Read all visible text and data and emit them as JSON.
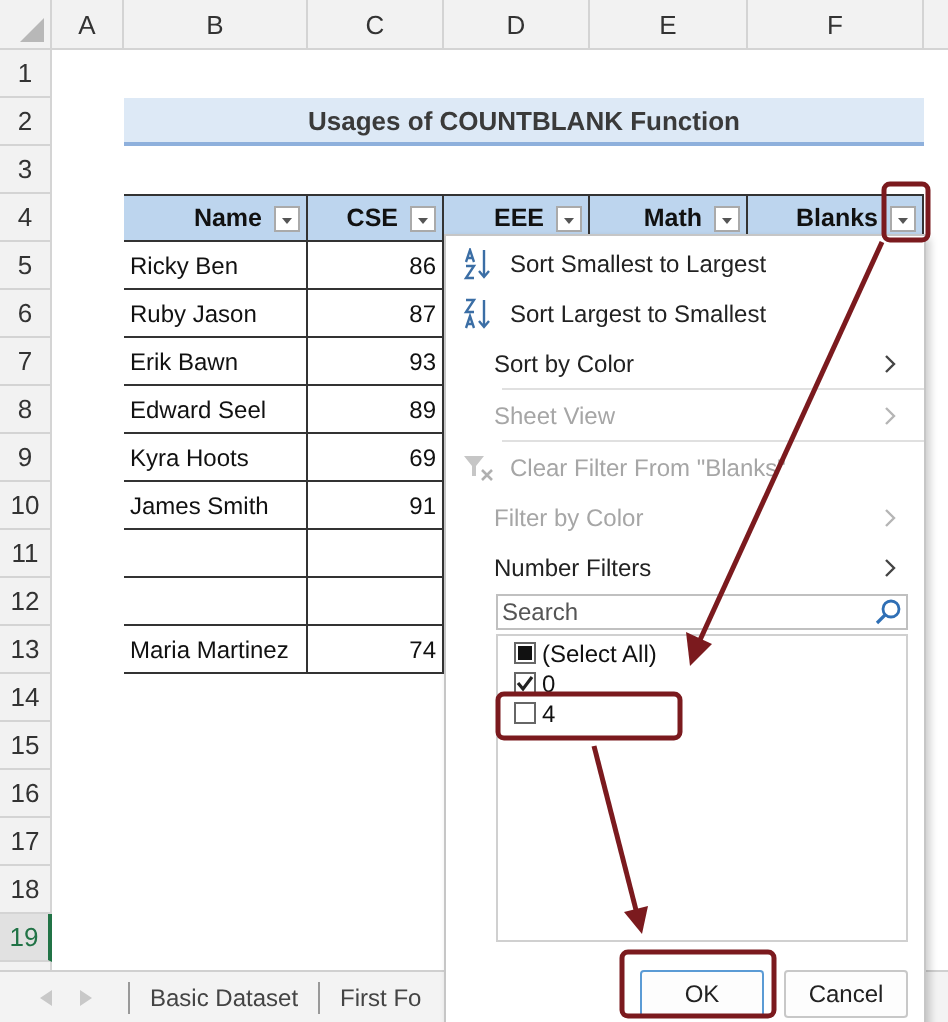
{
  "column_headers": [
    "A",
    "B",
    "C",
    "D",
    "E",
    "F"
  ],
  "row_headers": [
    {
      "label": "1",
      "selected": false
    },
    {
      "label": "2",
      "selected": false
    },
    {
      "label": "3",
      "selected": false
    },
    {
      "label": "4",
      "selected": false
    },
    {
      "label": "5",
      "selected": false
    },
    {
      "label": "6",
      "selected": false
    },
    {
      "label": "7",
      "selected": false
    },
    {
      "label": "8",
      "selected": false
    },
    {
      "label": "9",
      "selected": false
    },
    {
      "label": "10",
      "selected": false
    },
    {
      "label": "11",
      "selected": false
    },
    {
      "label": "12",
      "selected": false
    },
    {
      "label": "13",
      "selected": false
    },
    {
      "label": "14",
      "selected": false
    },
    {
      "label": "15",
      "selected": false
    },
    {
      "label": "16",
      "selected": false
    },
    {
      "label": "17",
      "selected": false
    },
    {
      "label": "18",
      "selected": false
    },
    {
      "label": "19",
      "selected": true
    }
  ],
  "title": "Usages of COUNTBLANK Function",
  "table": {
    "columns": [
      "Name",
      "CSE",
      "EEE",
      "Math",
      "Blanks"
    ],
    "rows": [
      {
        "name": "Ricky Ben",
        "cse": "86"
      },
      {
        "name": "Ruby Jason",
        "cse": "87"
      },
      {
        "name": "Erik Bawn",
        "cse": "93"
      },
      {
        "name": "Edward Seel",
        "cse": "89"
      },
      {
        "name": "Kyra Hoots",
        "cse": "69"
      },
      {
        "name": "James Smith",
        "cse": "91"
      },
      {},
      {},
      {
        "name": "Maria Martinez",
        "cse": "74"
      }
    ]
  },
  "filter_menu": {
    "items": [
      {
        "kind": "sort_asc",
        "label": "Sort Smallest to Largest",
        "disabled": false
      },
      {
        "kind": "sort_desc",
        "label": "Sort Largest to Smallest",
        "disabled": false
      },
      {
        "kind": "submenu",
        "label": "Sort by Color",
        "disabled": false
      },
      {
        "kind": "submenu",
        "label": "Sheet View",
        "disabled": true
      },
      {
        "kind": "clear_filter",
        "label": "Clear Filter From \"Blanks\"",
        "disabled": true
      },
      {
        "kind": "submenu",
        "label": "Filter by Color",
        "disabled": true
      },
      {
        "kind": "submenu",
        "label": "Number Filters",
        "disabled": false
      }
    ],
    "search": {
      "placeholder": "Search"
    },
    "values": [
      {
        "kind": "select_all",
        "label": "(Select All)",
        "mixed": true
      },
      {
        "kind": "value",
        "label": "0",
        "checked": true
      },
      {
        "kind": "value",
        "label": "4",
        "checked": false
      }
    ],
    "buttons": [
      "OK",
      "Cancel"
    ]
  },
  "sheet_tabs": [
    {
      "label": "Basic Dataset",
      "selected": false
    },
    {
      "label": "First Fo",
      "selected": false
    }
  ]
}
